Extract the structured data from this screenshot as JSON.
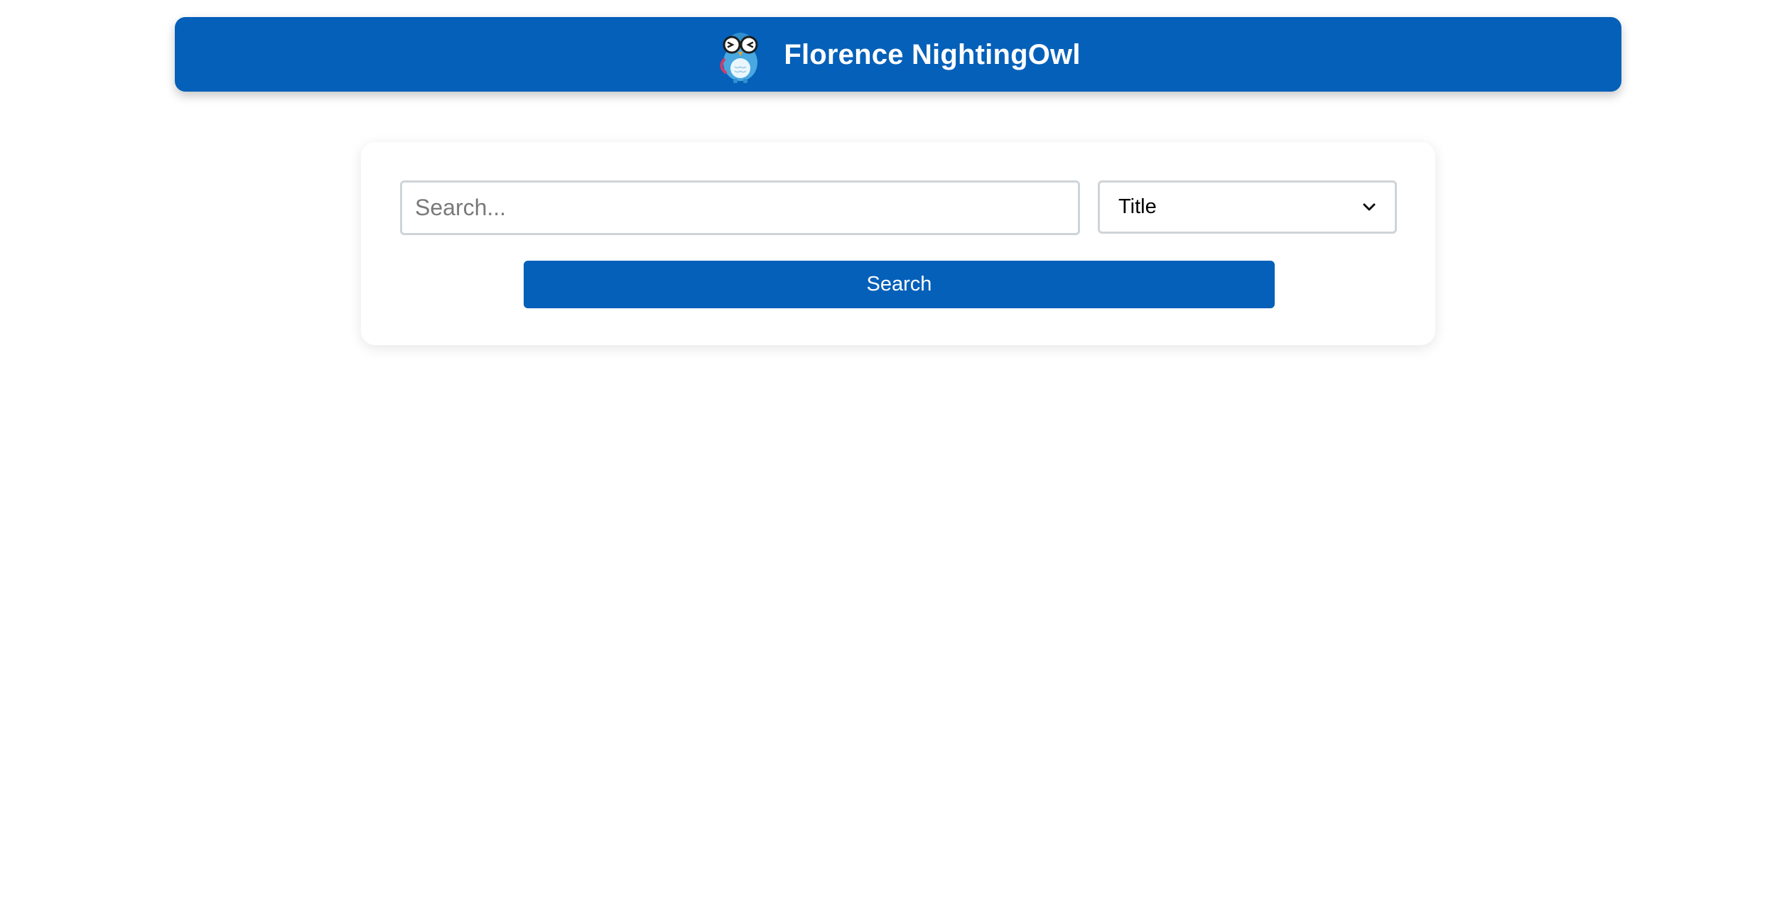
{
  "header": {
    "logo_icon": "owl-logo-icon",
    "title": "Florence NightingOwl",
    "background_color": "#0560b9"
  },
  "search": {
    "placeholder": "Search...",
    "value": "",
    "field_selected": "Title",
    "dropdown_icon": "chevron-down-icon",
    "button_label": "Search",
    "button_color": "#0560b9"
  }
}
